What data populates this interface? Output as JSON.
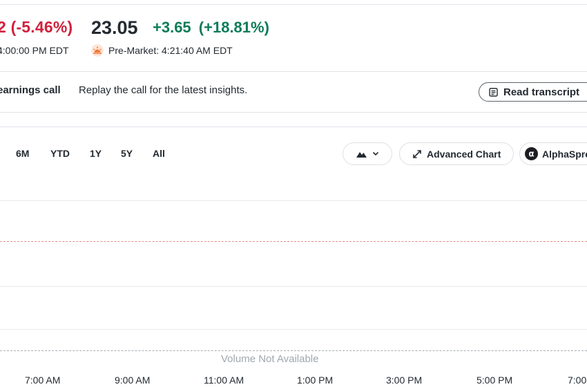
{
  "quote": {
    "regular_change_partial": "2 (-5.46%)",
    "close_time_partial": "4:00:00 PM EDT",
    "premarket_price": "23.05",
    "premarket_change": "+3.65",
    "premarket_change_pct": "(+18.81%)",
    "premarket_label": "Pre-Market: 4:21:40 AM EDT",
    "colors": {
      "negative": "#d1213d",
      "positive": "#0c7b58"
    }
  },
  "earnings_call": {
    "title_partial": "earnings call",
    "description": "Replay the call for the latest insights.",
    "transcript_button": "Read transcript",
    "transcript_icon": "document-icon"
  },
  "chart_toolbar": {
    "ranges": [
      "6M",
      "YTD",
      "1Y",
      "5Y",
      "All"
    ],
    "chart_type_icon": "mountain-chart-icon",
    "advanced_chart": "Advanced Chart",
    "advanced_chart_icon": "expand-arrows-icon",
    "alphaspread_partial": "AlphaSpread",
    "alphaspread_icon": "alpha-logo-icon"
  },
  "chart": {
    "volume_note": "Volume Not Available",
    "x_ticks": [
      "7:00 AM",
      "9:00 AM",
      "11:00 AM",
      "1:00 PM",
      "3:00 PM",
      "5:00 PM",
      "7:00"
    ]
  }
}
